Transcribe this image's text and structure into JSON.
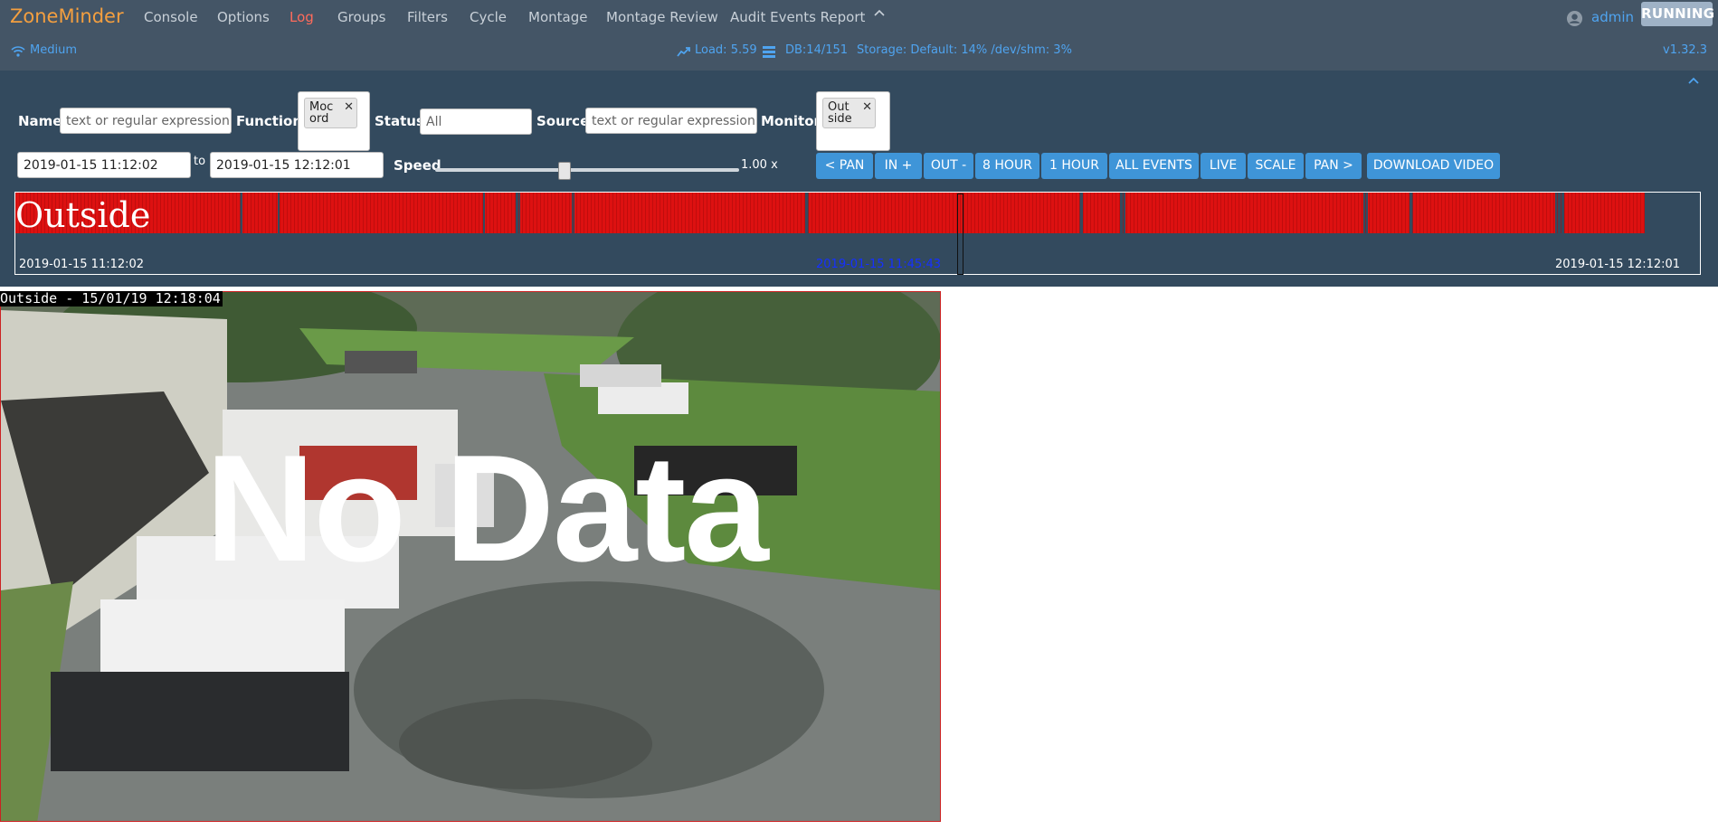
{
  "nav": {
    "brand": "ZoneMinder",
    "items": [
      "Console",
      "Options",
      "Log",
      "Groups",
      "Filters",
      "Cycle",
      "Montage",
      "Montage Review",
      "Audit Events Report"
    ],
    "active": "Log",
    "user": "admin",
    "state": "RUNNING"
  },
  "status": {
    "bandwidth": "Medium",
    "load": "Load: 5.59",
    "db": "DB:14/151",
    "storage": "Storage: Default: 14% /dev/shm: 3%",
    "version": "v1.32.3"
  },
  "filters": {
    "name_label": "Name",
    "name_placeholder": "text or regular expression",
    "function_label": "Function",
    "function_chip": "Mocord",
    "status_label": "Status",
    "status_placeholder": "All",
    "source_label": "Source",
    "source_placeholder": "text or regular expression",
    "monitor_label": "Monitor",
    "monitor_chip": "Outside",
    "start_time": "2019-01-15 11:12:02",
    "to_label": "to",
    "end_time": "2019-01-15 12:12:01",
    "speed_label": "Speed",
    "speed_value": "1.00 x",
    "speed_fraction": 0.35
  },
  "buttons": [
    "< PAN",
    "IN +",
    "OUT -",
    "8 HOUR",
    "1 HOUR",
    "ALL EVENTS",
    "LIVE",
    "SCALE",
    "PAN >",
    "DOWNLOAD VIDEO"
  ],
  "timeline": {
    "monitor": "Outside",
    "start": "2019-01-15 11:12:02",
    "current": "2019-01-15 11:45:43",
    "end": "2019-01-15 12:12:01",
    "event_color": "#dd1111"
  },
  "video": {
    "overlay": "Outside - 15/01/19 12:18:04",
    "nodata": "No Data"
  }
}
